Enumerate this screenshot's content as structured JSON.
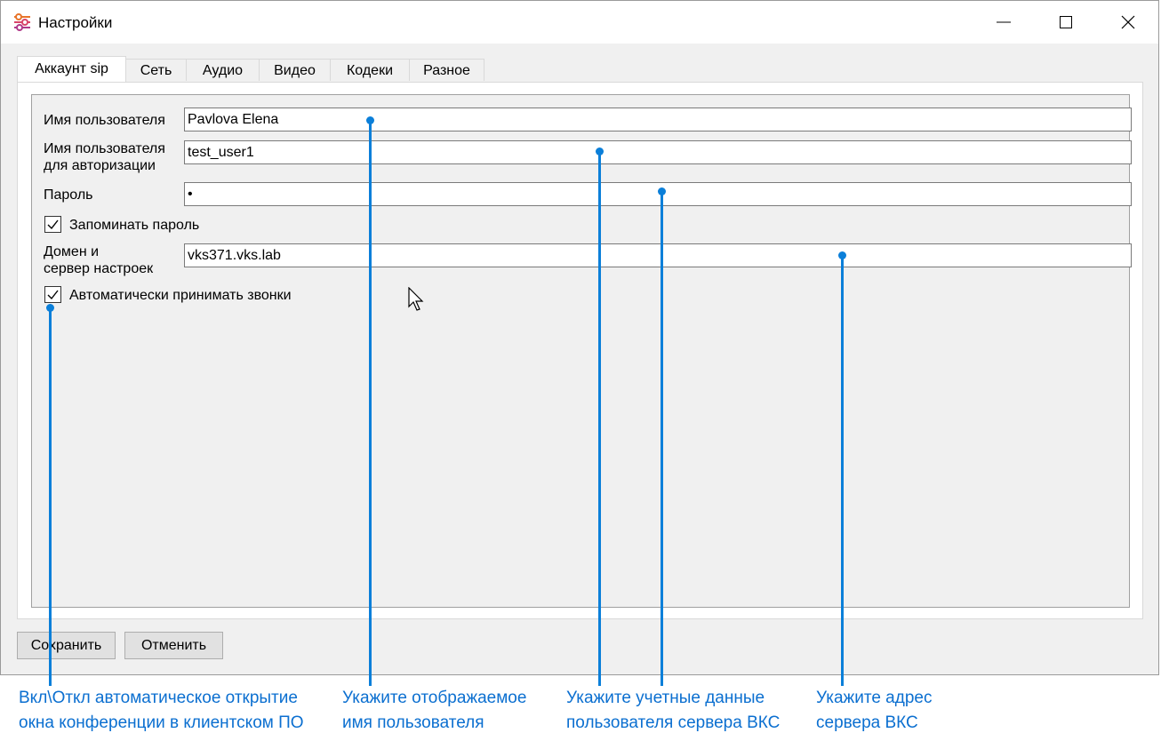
{
  "window": {
    "title": "Настройки",
    "controls": {
      "minimize": "minimize",
      "maximize": "maximize",
      "close": "close"
    }
  },
  "tabs": [
    {
      "label": "Аккаунт sip",
      "active": true
    },
    {
      "label": "Сеть",
      "active": false
    },
    {
      "label": "Аудио",
      "active": false
    },
    {
      "label": "Видео",
      "active": false
    },
    {
      "label": "Кодеки",
      "active": false
    },
    {
      "label": "Разное",
      "active": false
    }
  ],
  "form": {
    "username_label": "Имя пользователя",
    "username_value": "Pavlova Elena",
    "auth_label_line1": "Имя пользователя",
    "auth_label_line2": "для авторизации",
    "auth_value": "test_user1",
    "password_label": "Пароль",
    "password_value": "•",
    "remember_label": "Запоминать пароль",
    "remember_checked": true,
    "domain_label_line1": "Домен и",
    "domain_label_line2": "сервер настроек",
    "domain_value": "vks371.vks.lab",
    "autoanswer_label": "Автоматически принимать звонки",
    "autoanswer_checked": true
  },
  "buttons": {
    "save": "Сохранить",
    "cancel": "Отменить"
  },
  "callouts": [
    {
      "line1": "Вкл\\Откл автоматическое открытие",
      "line2": "окна конференции в клиентском ПО"
    },
    {
      "line1": "Укажите отображаемое",
      "line2": "имя пользователя"
    },
    {
      "line1": "Укажите учетные данные",
      "line2": "пользователя сервера ВКС"
    },
    {
      "line1": "Укажите адрес",
      "line2": "сервера ВКС"
    }
  ],
  "colors": {
    "accent": "#0b7fd9",
    "window_bg": "#f0f0f0",
    "panel_bg": "#ffffff"
  }
}
